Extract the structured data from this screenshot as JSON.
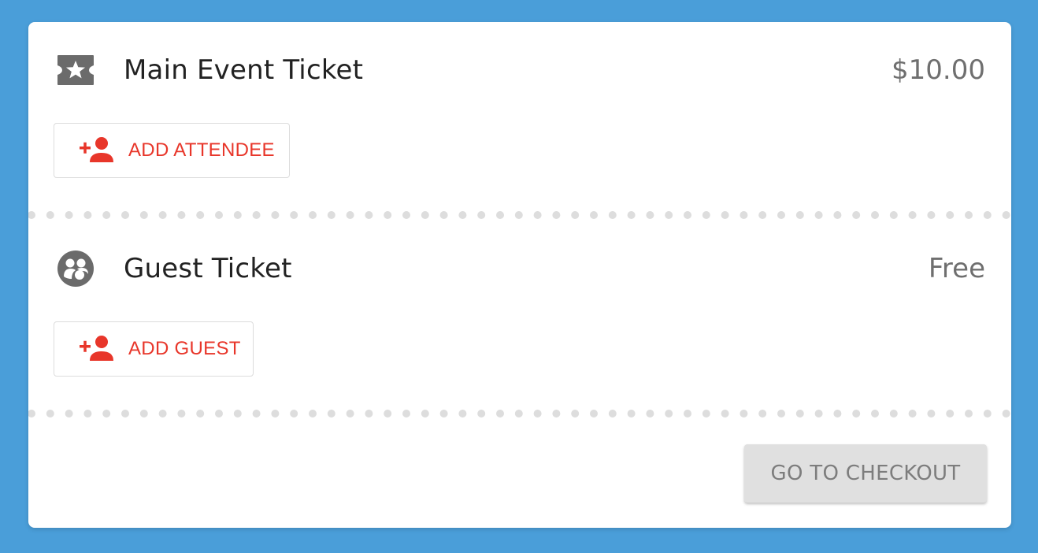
{
  "tickets": [
    {
      "name": "Main Event Ticket",
      "price": "$10.00",
      "icon": "ticket-star-icon",
      "action_label": "ADD ATTENDEE",
      "action_icon": "person-add-icon"
    },
    {
      "name": "Guest Ticket",
      "price": "Free",
      "icon": "group-circle-icon",
      "action_label": "ADD GUEST",
      "action_icon": "person-add-icon"
    }
  ],
  "checkout": {
    "label": "GO TO CHECKOUT"
  },
  "colors": {
    "background": "#4a9ed9",
    "accent": "#e8362a",
    "icon": "#6b6b6b",
    "checkout_bg": "#e0e0e0"
  }
}
